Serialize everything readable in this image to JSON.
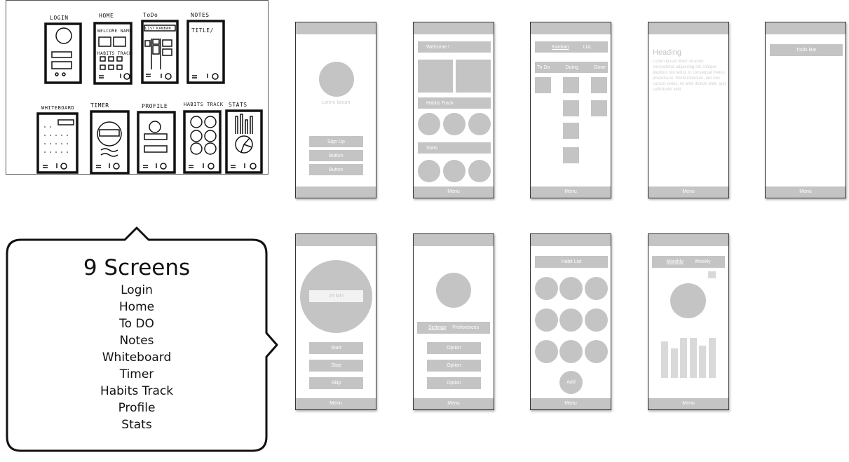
{
  "sketch": {
    "labels": [
      "LOGIN",
      "HOME",
      "ToDo",
      "NOTES",
      "WHITEBOARD",
      "TIMER",
      "PROFILE",
      "HABITS TRACK",
      "STATS"
    ],
    "home_welcome": "WELCOME NAME",
    "home_habits": "HABITS TRACK",
    "todo_tabs": [
      "LIST",
      "KANBAN"
    ],
    "notes_title": "TITLE/"
  },
  "summary": {
    "title": "9 Screens",
    "items": [
      "Login",
      "Home",
      "To DO",
      "Notes",
      "Whiteboard",
      "Timer",
      "Habits Track",
      "Profile",
      "Stats"
    ]
  },
  "colors": {
    "wire_gray": "#c4c4c4",
    "wire_light": "#d9d9d9"
  },
  "wireframes": {
    "menu": "Menu",
    "login": {
      "caption": "Lorem Ipsum",
      "buttons": [
        "Sign Up",
        "Button",
        "Button"
      ]
    },
    "home": {
      "welcome": "Welcome !",
      "habits": "Habits Track",
      "stats": "Stats"
    },
    "todo": {
      "tabs": [
        "Kanban",
        "List"
      ],
      "columns": [
        "To Do",
        "Doing",
        "Done"
      ]
    },
    "notes": {
      "heading": "Heading",
      "body": "Lorem ipsum dolor sit amet, consectetur adipiscing elit. Integer dapibus nisl tellus, in consequat metus pharetra et. Morbi interdum, nisi nec cursus varius, mi ante dictum ante, quis sollicitudin velit."
    },
    "whiteboard": {
      "toolbar": "Tools Bar"
    },
    "timer": {
      "time": "25 Min",
      "buttons": [
        "Start",
        "Stop",
        "Skip"
      ]
    },
    "profile": {
      "tabs": [
        "Settings",
        "Preferences"
      ],
      "options": [
        "Option",
        "Option",
        "Option"
      ]
    },
    "habits": {
      "header": "Habit List",
      "add": "Add"
    },
    "stats": {
      "tabs": [
        "Monthly",
        "Weekly"
      ],
      "bar_levels": [
        0.77,
        0.62,
        0.84,
        0.84,
        0.67,
        0.84
      ]
    }
  }
}
